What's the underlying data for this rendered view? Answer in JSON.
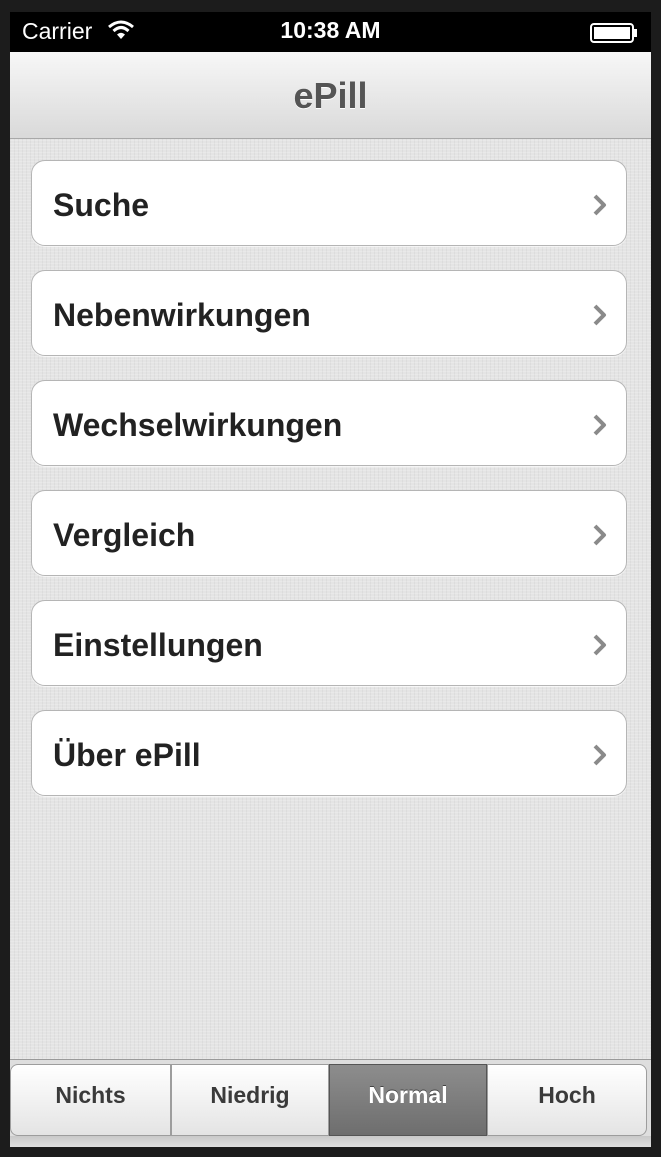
{
  "status_bar": {
    "carrier": "Carrier",
    "time": "10:38 AM",
    "wifi_icon": "wifi-icon",
    "battery_icon": "battery-icon"
  },
  "nav": {
    "title": "ePill"
  },
  "menu": {
    "items": [
      {
        "label": "Suche"
      },
      {
        "label": "Nebenwirkungen"
      },
      {
        "label": "Wechselwirkungen"
      },
      {
        "label": "Vergleich"
      },
      {
        "label": "Einstellungen"
      },
      {
        "label": "Über ePill"
      }
    ],
    "chevron_icon": "chevron-right-icon"
  },
  "segments": {
    "options": [
      "Nichts",
      "Niedrig",
      "Normal",
      "Hoch"
    ],
    "selected": "Normal"
  },
  "colors": {
    "status_bar": "#000000",
    "selected_segment": "#7d7d7d",
    "label_text": "#222222"
  }
}
